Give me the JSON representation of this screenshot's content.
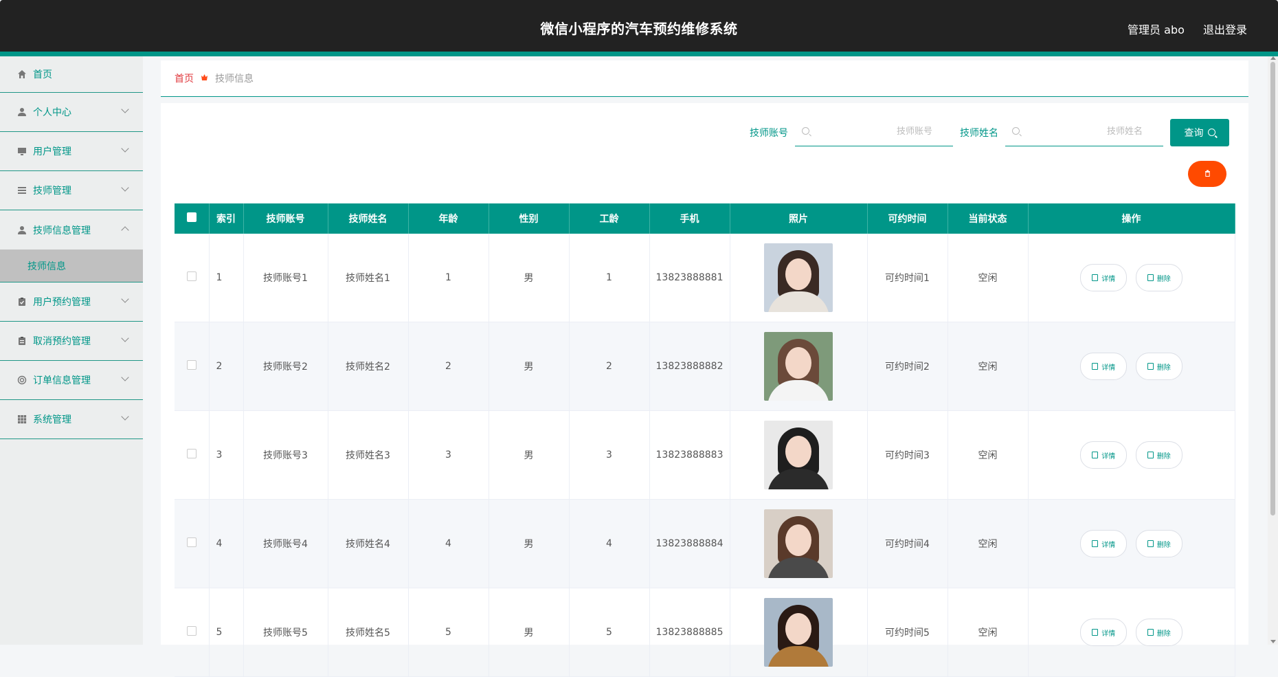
{
  "header": {
    "title": "微信小程序的汽车预约维修系统",
    "user": "管理员 abo",
    "logout": "退出登录"
  },
  "sidebar": {
    "items": [
      {
        "label": "首页",
        "icon": "home-icon"
      },
      {
        "label": "个人中心",
        "icon": "user-icon"
      },
      {
        "label": "用户管理",
        "icon": "monitor-icon"
      },
      {
        "label": "技师管理",
        "icon": "list-icon"
      },
      {
        "label": "技师信息管理",
        "icon": "user-icon",
        "expanded": true
      },
      {
        "label": "用户预约管理",
        "icon": "clipboard-check-icon"
      },
      {
        "label": "取消预约管理",
        "icon": "clipboard-icon"
      },
      {
        "label": "订单信息管理",
        "icon": "lifebuoy-icon"
      },
      {
        "label": "系统管理",
        "icon": "grid-icon"
      }
    ],
    "subitem": "技师信息"
  },
  "breadcrumb": {
    "home": "首页",
    "current": "技师信息"
  },
  "search": {
    "account_label": "技师账号",
    "account_placeholder": "技师账号",
    "name_label": "技师姓名",
    "name_placeholder": "技师姓名",
    "query_label": "查询"
  },
  "table": {
    "headers": [
      "索引",
      "技师账号",
      "技师姓名",
      "年龄",
      "性别",
      "工龄",
      "手机",
      "照片",
      "可约时间",
      "当前状态",
      "操作"
    ],
    "rows": [
      {
        "index": "1",
        "account": "技师账号1",
        "name": "技师姓名1",
        "age": "1",
        "gender": "男",
        "years": "1",
        "phone": "13823888881",
        "time": "可约时间1",
        "status": "空闲"
      },
      {
        "index": "2",
        "account": "技师账号2",
        "name": "技师姓名2",
        "age": "2",
        "gender": "男",
        "years": "2",
        "phone": "13823888882",
        "time": "可约时间2",
        "status": "空闲"
      },
      {
        "index": "3",
        "account": "技师账号3",
        "name": "技师姓名3",
        "age": "3",
        "gender": "男",
        "years": "3",
        "phone": "13823888883",
        "time": "可约时间3",
        "status": "空闲"
      },
      {
        "index": "4",
        "account": "技师账号4",
        "name": "技师姓名4",
        "age": "4",
        "gender": "男",
        "years": "4",
        "phone": "13823888884",
        "time": "可约时间4",
        "status": "空闲"
      },
      {
        "index": "5",
        "account": "技师账号5",
        "name": "技师姓名5",
        "age": "5",
        "gender": "男",
        "years": "5",
        "phone": "13823888885",
        "time": "可约时间5",
        "status": "空闲"
      }
    ],
    "detail_label": "详情",
    "delete_label": "删除"
  },
  "colors": {
    "primary": "#009688",
    "header_bg": "#222222",
    "danger": "#ff4a00",
    "breadcrumb_home": "#e0393e"
  }
}
